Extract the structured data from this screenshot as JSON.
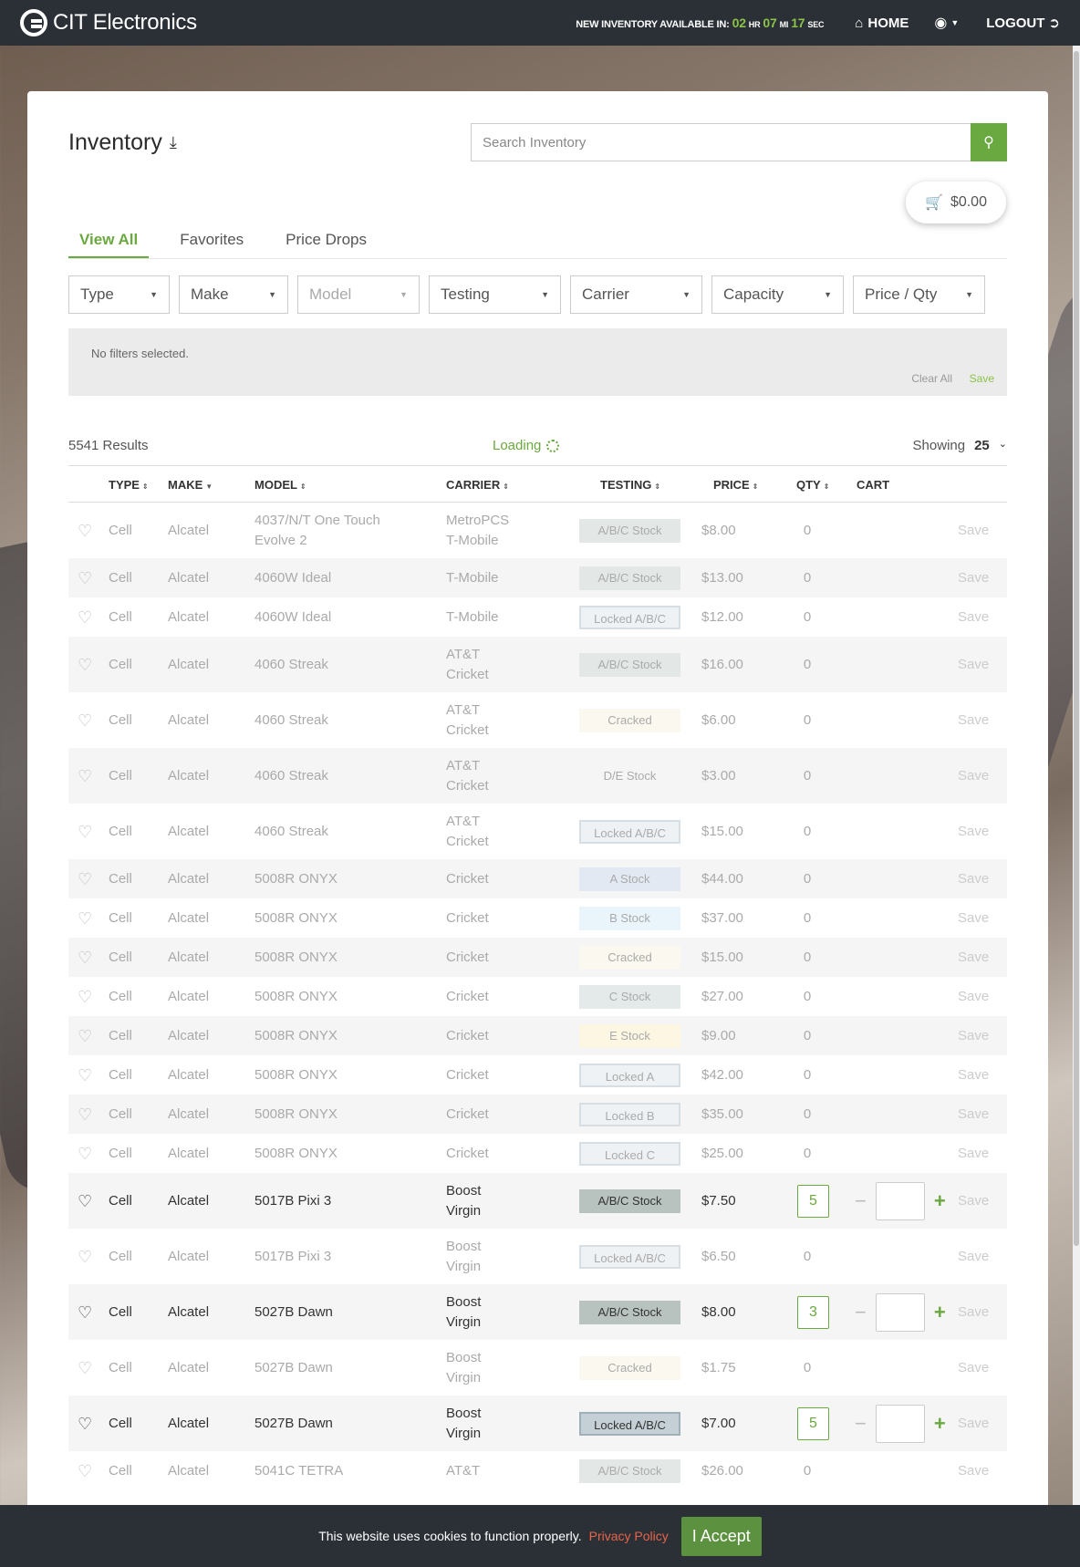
{
  "header": {
    "brand": "CIT Electronics",
    "countdown_label": "NEW INVENTORY AVAILABLE IN:",
    "hours": "02",
    "hours_unit": "HR",
    "minutes": "07",
    "minutes_unit": "MI",
    "seconds": "17",
    "seconds_unit": "SEC",
    "home_label": "HOME",
    "logout_label": "LOGOUT"
  },
  "page": {
    "title": "Inventory",
    "search_placeholder": "Search Inventory",
    "cart_total": "$0.00"
  },
  "tabs": [
    {
      "label": "View All",
      "active": true
    },
    {
      "label": "Favorites"
    },
    {
      "label": "Price Drops"
    }
  ],
  "filters": [
    {
      "label": "Type"
    },
    {
      "label": "Make"
    },
    {
      "label": "Model",
      "disabled": true
    },
    {
      "label": "Testing"
    },
    {
      "label": "Carrier"
    },
    {
      "label": "Capacity"
    },
    {
      "label": "Price / Qty"
    }
  ],
  "filter_box": {
    "empty_text": "No filters selected.",
    "clear_label": "Clear All",
    "save_label": "Save"
  },
  "results": {
    "count": "5541 Results",
    "loading": "Loading",
    "showing_label": "Showing",
    "showing_value": "25"
  },
  "table": {
    "headers": [
      "TYPE",
      "MAKE",
      "MODEL",
      "CARRIER",
      "TESTING",
      "PRICE",
      "QTY",
      "CART"
    ],
    "save_label": "Save",
    "rows": [
      {
        "type": "Cell",
        "make": "Alcatel",
        "model": "4037/N/T One Touch Evolve 2",
        "carrier": "MetroPCS\nT-Mobile",
        "testing": "A/B/C Stock",
        "badge": "abc",
        "price": "$8.00",
        "qty": "0"
      },
      {
        "type": "Cell",
        "make": "Alcatel",
        "model": "4060W Ideal",
        "carrier": "T-Mobile",
        "testing": "A/B/C Stock",
        "badge": "abc",
        "price": "$13.00",
        "qty": "0"
      },
      {
        "type": "Cell",
        "make": "Alcatel",
        "model": "4060W Ideal",
        "carrier": "T-Mobile",
        "testing": "Locked A/B/C",
        "badge": "locked",
        "price": "$12.00",
        "qty": "0"
      },
      {
        "type": "Cell",
        "make": "Alcatel",
        "model": "4060 Streak",
        "carrier": "AT&T\nCricket",
        "testing": "A/B/C Stock",
        "badge": "abc",
        "price": "$16.00",
        "qty": "0"
      },
      {
        "type": "Cell",
        "make": "Alcatel",
        "model": "4060 Streak",
        "carrier": "AT&T\nCricket",
        "testing": "Cracked",
        "badge": "cracked",
        "price": "$6.00",
        "qty": "0"
      },
      {
        "type": "Cell",
        "make": "Alcatel",
        "model": "4060 Streak",
        "carrier": "AT&T\nCricket",
        "testing": "D/E Stock",
        "badge": "de",
        "price": "$3.00",
        "qty": "0"
      },
      {
        "type": "Cell",
        "make": "Alcatel",
        "model": "4060 Streak",
        "carrier": "AT&T\nCricket",
        "testing": "Locked A/B/C",
        "badge": "locked",
        "price": "$15.00",
        "qty": "0"
      },
      {
        "type": "Cell",
        "make": "Alcatel",
        "model": "5008R ONYX",
        "carrier": "Cricket",
        "testing": "A Stock",
        "badge": "a",
        "price": "$44.00",
        "qty": "0"
      },
      {
        "type": "Cell",
        "make": "Alcatel",
        "model": "5008R ONYX",
        "carrier": "Cricket",
        "testing": "B Stock",
        "badge": "b",
        "price": "$37.00",
        "qty": "0"
      },
      {
        "type": "Cell",
        "make": "Alcatel",
        "model": "5008R ONYX",
        "carrier": "Cricket",
        "testing": "Cracked",
        "badge": "cracked",
        "price": "$15.00",
        "qty": "0"
      },
      {
        "type": "Cell",
        "make": "Alcatel",
        "model": "5008R ONYX",
        "carrier": "Cricket",
        "testing": "C Stock",
        "badge": "c",
        "price": "$27.00",
        "qty": "0"
      },
      {
        "type": "Cell",
        "make": "Alcatel",
        "model": "5008R ONYX",
        "carrier": "Cricket",
        "testing": "E Stock",
        "badge": "e",
        "price": "$9.00",
        "qty": "0"
      },
      {
        "type": "Cell",
        "make": "Alcatel",
        "model": "5008R ONYX",
        "carrier": "Cricket",
        "testing": "Locked A",
        "badge": "locked",
        "price": "$42.00",
        "qty": "0"
      },
      {
        "type": "Cell",
        "make": "Alcatel",
        "model": "5008R ONYX",
        "carrier": "Cricket",
        "testing": "Locked B",
        "badge": "locked",
        "price": "$35.00",
        "qty": "0"
      },
      {
        "type": "Cell",
        "make": "Alcatel",
        "model": "5008R ONYX",
        "carrier": "Cricket",
        "testing": "Locked C",
        "badge": "locked",
        "price": "$25.00",
        "qty": "0"
      },
      {
        "type": "Cell",
        "make": "Alcatel",
        "model": "5017B Pixi 3",
        "carrier": "Boost\nVirgin",
        "testing": "A/B/C Stock",
        "badge": "abc",
        "price": "$7.50",
        "qty": "5",
        "available": true
      },
      {
        "type": "Cell",
        "make": "Alcatel",
        "model": "5017B Pixi 3",
        "carrier": "Boost\nVirgin",
        "testing": "Locked A/B/C",
        "badge": "locked",
        "price": "$6.50",
        "qty": "0"
      },
      {
        "type": "Cell",
        "make": "Alcatel",
        "model": "5027B Dawn",
        "carrier": "Boost\nVirgin",
        "testing": "A/B/C Stock",
        "badge": "abc",
        "price": "$8.00",
        "qty": "3",
        "available": true
      },
      {
        "type": "Cell",
        "make": "Alcatel",
        "model": "5027B Dawn",
        "carrier": "Boost\nVirgin",
        "testing": "Cracked",
        "badge": "cracked",
        "price": "$1.75",
        "qty": "0"
      },
      {
        "type": "Cell",
        "make": "Alcatel",
        "model": "5027B Dawn",
        "carrier": "Boost\nVirgin",
        "testing": "Locked A/B/C",
        "badge": "locked",
        "price": "$7.00",
        "qty": "5",
        "available": true
      },
      {
        "type": "Cell",
        "make": "Alcatel",
        "model": "5041C TETRA",
        "carrier": "AT&T",
        "testing": "A/B/C Stock",
        "badge": "abc",
        "price": "$26.00",
        "qty": "0"
      }
    ]
  },
  "cookie": {
    "text": "This website uses cookies to function properly.",
    "policy_link": "Privacy Policy",
    "accept_label": "I Accept"
  },
  "colors": {
    "accent_green": "#6aa840",
    "header_bg": "#2b3036"
  }
}
